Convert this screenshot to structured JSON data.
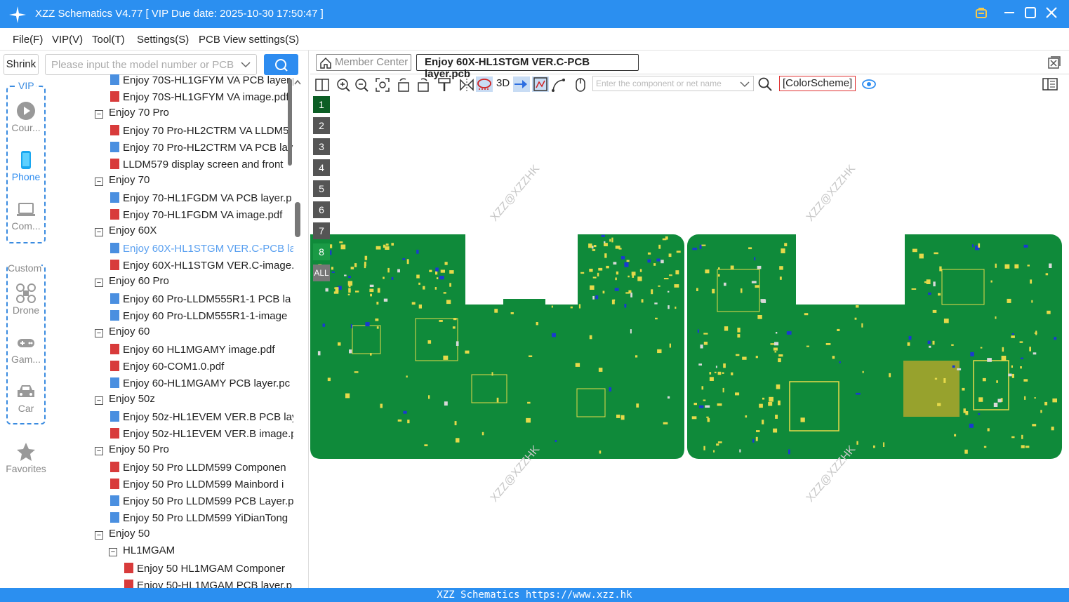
{
  "app": {
    "title": "XZZ Schematics V4.77 [ VIP Due date: 2025-10-30 17:50:47 ]"
  },
  "menu": [
    "File(F)",
    "VIP(V)",
    "Tool(T)",
    "Settings(S)",
    "PCB View settings(S)"
  ],
  "sidebar": {
    "shrink_label": "Shrink",
    "vip_label": "VIP",
    "vip_items": [
      {
        "label": "Cour...",
        "icon": "play-icon"
      },
      {
        "label": "Phone",
        "icon": "phone-icon",
        "active": true
      },
      {
        "label": "Com...",
        "icon": "laptop-icon"
      }
    ],
    "custom_label": "Custom",
    "custom_items": [
      {
        "label": "Drone",
        "icon": "drone-icon"
      },
      {
        "label": "Gam...",
        "icon": "gamepad-icon"
      },
      {
        "label": "Car",
        "icon": "car-icon"
      }
    ],
    "favorites_label": "Favorites"
  },
  "search": {
    "placeholder": "Please input the model number or PCB"
  },
  "tree": [
    {
      "type": "pcb",
      "label": "Enjoy 70S-HL1GFYM VA PCB layer.p",
      "indent": 1
    },
    {
      "type": "pdf",
      "label": "Enjoy 70S-HL1GFYM VA image.pdf",
      "indent": 1
    },
    {
      "type": "folder",
      "label": "Enjoy 70 Pro",
      "indent": 0
    },
    {
      "type": "pdf",
      "label": "Enjoy 70 Pro-HL2CTRM VA LLDM5",
      "indent": 1
    },
    {
      "type": "pcb",
      "label": "Enjoy 70 Pro-HL2CTRM VA PCB lay",
      "indent": 1
    },
    {
      "type": "pdf",
      "label": "LLDM579 display screen and front",
      "indent": 1
    },
    {
      "type": "folder",
      "label": "Enjoy 70",
      "indent": 0
    },
    {
      "type": "pcb",
      "label": "Enjoy 70-HL1FGDM VA PCB layer.p",
      "indent": 1
    },
    {
      "type": "pdf",
      "label": "Enjoy 70-HL1FGDM VA image.pdf",
      "indent": 1
    },
    {
      "type": "folder",
      "label": "Enjoy 60X",
      "indent": 0
    },
    {
      "type": "pcb",
      "label": "Enjoy 60X-HL1STGM VER.C-PCB lay",
      "indent": 1,
      "selected": true
    },
    {
      "type": "pdf",
      "label": "Enjoy 60X-HL1STGM VER.C-image.",
      "indent": 1
    },
    {
      "type": "folder",
      "label": "Enjoy 60 Pro",
      "indent": 0
    },
    {
      "type": "pcb",
      "label": "Enjoy 60 Pro-LLDM555R1-1 PCB la",
      "indent": 1
    },
    {
      "type": "pcb",
      "label": "Enjoy 60 Pro-LLDM555R1-1-image",
      "indent": 1
    },
    {
      "type": "folder",
      "label": "Enjoy 60",
      "indent": 0
    },
    {
      "type": "pdf",
      "label": "Enjoy 60 HL1MGAMY image.pdf",
      "indent": 1
    },
    {
      "type": "pdf",
      "label": "Enjoy 60-COM1.0.pdf",
      "indent": 1
    },
    {
      "type": "pcb",
      "label": "Enjoy 60-HL1MGAMY PCB layer.pc",
      "indent": 1
    },
    {
      "type": "folder",
      "label": "Enjoy 50z",
      "indent": 0
    },
    {
      "type": "pcb",
      "label": "Enjoy 50z-HL1EVEM VER.B PCB lay",
      "indent": 1
    },
    {
      "type": "pdf",
      "label": "Enjoy 50z-HL1EVEM VER.B image.p",
      "indent": 1
    },
    {
      "type": "folder",
      "label": "Enjoy 50 Pro",
      "indent": 0
    },
    {
      "type": "pdf",
      "label": "Enjoy 50 Pro LLDM599 Componen",
      "indent": 1
    },
    {
      "type": "pdf",
      "label": "Enjoy 50 Pro LLDM599 Mainbord i",
      "indent": 1
    },
    {
      "type": "pcb",
      "label": "Enjoy 50 Pro LLDM599 PCB Layer.p",
      "indent": 1
    },
    {
      "type": "pcb",
      "label": "Enjoy 50 Pro LLDM599 YiDianTong",
      "indent": 1
    },
    {
      "type": "folder",
      "label": "Enjoy 50",
      "indent": 0
    },
    {
      "type": "folder",
      "label": "HL1MGAM",
      "indent": 1
    },
    {
      "type": "pdf",
      "label": "Enjoy 50 HL1MGAM Componer",
      "indent": 2
    },
    {
      "type": "pdf",
      "label": "Enjoy 50-HL1MGAM PCB layer.p",
      "indent": 2
    }
  ],
  "tabs": {
    "member_center": "Member Center",
    "active_file": "Enjoy 60X-HL1STGM VER.C-PCB layer.pcb"
  },
  "toolbar": {
    "threed": "3D",
    "component_search_placeholder": "Enter the component or net name",
    "color_scheme": "[ColorScheme]"
  },
  "layers": [
    "1",
    "2",
    "3",
    "4",
    "5",
    "6",
    "7",
    "8",
    "ALL"
  ],
  "watermark": "XZZ@XZZHK",
  "status": "XZZ Schematics https://www.xzz.hk",
  "colors": {
    "accent": "#2b8ff0",
    "pcb_green": "#0f8a3a",
    "pad_yellow": "#e6d94a",
    "color_scheme_border": "#e03030"
  }
}
